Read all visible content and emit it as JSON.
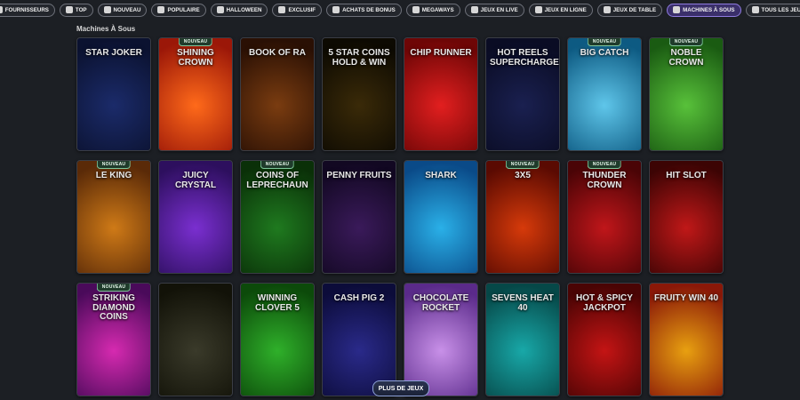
{
  "filters": [
    {
      "label": "FOURNISSEURS",
      "icon": "providers-icon",
      "active": false
    },
    {
      "label": "TOP",
      "icon": "trophy-icon",
      "active": false
    },
    {
      "label": "NOUVEAU",
      "icon": "lightning-icon",
      "active": false
    },
    {
      "label": "POPULAIRE",
      "icon": "thumbs-up-icon",
      "active": false
    },
    {
      "label": "HALLOWEEN",
      "icon": "pumpkin-icon",
      "active": false
    },
    {
      "label": "EXCLUSIF",
      "icon": "diamond-icon",
      "active": false
    },
    {
      "label": "ACHATS DE BONUS",
      "icon": "bonus-icon",
      "active": false
    },
    {
      "label": "MEGAWAYS",
      "icon": "megaways-icon",
      "active": false
    },
    {
      "label": "JEUX EN LIVE",
      "icon": "live-icon",
      "active": false
    },
    {
      "label": "JEUX EN LIGNE",
      "icon": "online-icon",
      "active": false
    },
    {
      "label": "JEUX DE TABLE",
      "icon": "table-icon",
      "active": false
    },
    {
      "label": "MACHINES À SOUS",
      "icon": "slot-icon",
      "active": true
    },
    {
      "label": "TOUS LES JEUX",
      "icon": "all-games-icon",
      "active": false
    }
  ],
  "section_title": "Machines À Sous",
  "new_badge": "NOUVEAU",
  "games": [
    {
      "title": "STAR JOKER",
      "badge": false,
      "c1": "#1b2b6a",
      "c2": "#0b1230"
    },
    {
      "title": "SHINING CROWN",
      "badge": true,
      "c1": "#ff6a1a",
      "c2": "#9b1708"
    },
    {
      "title": "BOOK OF RA",
      "badge": false,
      "c1": "#7a3c10",
      "c2": "#2a1004"
    },
    {
      "title": "5 STAR COINS HOLD & WIN",
      "badge": false,
      "c1": "#3a2a08",
      "c2": "#0d0a02"
    },
    {
      "title": "CHIP RUNNER",
      "badge": false,
      "c1": "#e21f1f",
      "c2": "#6e0606"
    },
    {
      "title": "HOT REELS SUPERCHARGED",
      "badge": false,
      "c1": "#1a2050",
      "c2": "#0a0c24"
    },
    {
      "title": "BIG CATCH",
      "badge": true,
      "c1": "#5fc6ea",
      "c2": "#0d5a82"
    },
    {
      "title": "NOBLE CROWN",
      "badge": true,
      "c1": "#58c13a",
      "c2": "#1a5b12"
    },
    {
      "title": "LE KING",
      "badge": true,
      "c1": "#cf7a17",
      "c2": "#5a2a08"
    },
    {
      "title": "JUICY CRYSTAL",
      "badge": false,
      "c1": "#7a2fd0",
      "c2": "#2d0f5e"
    },
    {
      "title": "COINS OF LEPRECHAUN",
      "badge": true,
      "c1": "#1f7a1f",
      "c2": "#0a3008"
    },
    {
      "title": "PENNY FRUITS",
      "badge": false,
      "c1": "#3a1a5a",
      "c2": "#120822"
    },
    {
      "title": "SHARK",
      "badge": false,
      "c1": "#2ab0e8",
      "c2": "#0a4a88"
    },
    {
      "title": "3X5",
      "badge": true,
      "c1": "#d63a0a",
      "c2": "#5a0a02"
    },
    {
      "title": "THUNDER CROWN",
      "badge": true,
      "c1": "#c0161a",
      "c2": "#4a0406"
    },
    {
      "title": "HIT SLOT",
      "badge": false,
      "c1": "#c01818",
      "c2": "#3c0404"
    },
    {
      "title": "STRIKING DIAMOND COINS",
      "badge": true,
      "c1": "#d62ab0",
      "c2": "#4a0a5a"
    },
    {
      "title": "",
      "badge": false,
      "c1": "#3a3a2a",
      "c2": "#121208"
    },
    {
      "title": "WINNING CLOVER 5",
      "badge": false,
      "c1": "#2fb02a",
      "c2": "#0c4a0a"
    },
    {
      "title": "CASH PIG 2",
      "badge": false,
      "c1": "#2a2a8a",
      "c2": "#0c0c3a"
    },
    {
      "title": "CHOCOLATE ROCKET",
      "badge": false,
      "c1": "#c890e8",
      "c2": "#5a2a8a"
    },
    {
      "title": "SEVENS HEAT 40",
      "badge": false,
      "c1": "#18a8a8",
      "c2": "#064848"
    },
    {
      "title": "HOT & SPICY JACKPOT",
      "badge": false,
      "c1": "#c41414",
      "c2": "#4a0404"
    },
    {
      "title": "FRUITY WIN 40",
      "badge": false,
      "c1": "#e8a010",
      "c2": "#8a1808"
    }
  ],
  "more_button": "PLUS DE JEUX"
}
